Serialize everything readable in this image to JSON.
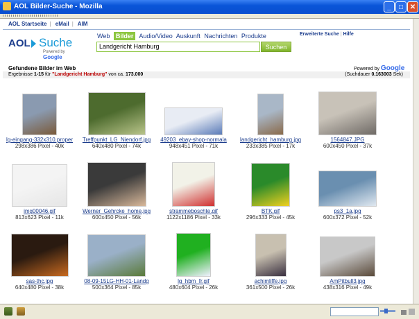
{
  "window": {
    "title": "AOL Bilder-Suche - Mozilla"
  },
  "topnav": [
    "AOL Startseite",
    "eMail",
    "AIM"
  ],
  "logo": {
    "brand": "AOL",
    "product": "Suche",
    "powered": "Powered by",
    "google": "Google"
  },
  "tabs": [
    "Web",
    "Bilder",
    "Audio/Video",
    "Auskunft",
    "Nachrichten",
    "Produkte"
  ],
  "active_tab": "Bilder",
  "search": {
    "value": "Landgericht Hamburg",
    "button": "Suchen"
  },
  "sidelinks": [
    "Erweiterte Suche",
    "Hilfe"
  ],
  "heading": "Gefundene Bilder im Web",
  "powered_right": {
    "text": "Powered by",
    "google": "Google"
  },
  "results": {
    "prefix": "Ergebnisse",
    "range": "1-15",
    "for": "für",
    "query": "\"Landgericht Hamburg\"",
    "of": "von ca.",
    "total": "173.000",
    "duration_label": "(Suchdauer",
    "duration": "0.163003",
    "duration_unit": "Sek)"
  },
  "images": [
    {
      "file": "lg-eingang-332x310.proper",
      "meta": "298x386 Pixel - 40k",
      "tw": 50,
      "th": 60,
      "colors": [
        "#8a9ab0",
        "#7a5a3a"
      ]
    },
    {
      "file": "Treffpunkt_LG_Niendorf.jpg",
      "meta": "640x480 Pixel - 74k",
      "tw": 83,
      "th": 62,
      "colors": [
        "#4d6b2e",
        "#b9c48a"
      ]
    },
    {
      "file": "49203_ebay-shop-normala",
      "meta": "948x451 Pixel - 71k",
      "tw": 84,
      "th": 40,
      "colors": [
        "#e8ecf4",
        "#5a7bb8"
      ]
    },
    {
      "file": "landgericht_hamburg.jpg",
      "meta": "233x385 Pixel - 17k",
      "tw": 38,
      "th": 60,
      "colors": [
        "#a9b7c7",
        "#8a6a4a"
      ]
    },
    {
      "file": "1564847.JPG",
      "meta": "600x450 Pixel - 37k",
      "tw": 84,
      "th": 63,
      "colors": [
        "#c8c2b8",
        "#6f6a66"
      ]
    },
    {
      "file": "img00046.gif",
      "meta": "813x623 Pixel - 11k",
      "tw": 80,
      "th": 61,
      "colors": [
        "#f4f4f4",
        "#e6e6e6"
      ]
    },
    {
      "file": "Werner_Gehrcke_home.jpg",
      "meta": "600x450 Pixel - 56k",
      "tw": 85,
      "th": 64,
      "colors": [
        "#3a3a3a",
        "#d8b89a"
      ]
    },
    {
      "file": "strammeboschte.gif",
      "meta": "1122x1186 Pixel - 33k",
      "tw": 62,
      "th": 64,
      "colors": [
        "#f2f2e8",
        "#d03030"
      ]
    },
    {
      "file": "BTK.gif",
      "meta": "296x333 Pixel - 45k",
      "tw": 56,
      "th": 63,
      "colors": [
        "#2a8a2a",
        "#f0d020"
      ]
    },
    {
      "file": "ps3_1a.jpg",
      "meta": "600x372 Pixel - 52k",
      "tw": 84,
      "th": 52,
      "colors": [
        "#6a8fb0",
        "#e0e8f0"
      ]
    },
    {
      "file": "sas-thc.jpg",
      "meta": "640x480 Pixel - 38k",
      "tw": 83,
      "th": 62,
      "colors": [
        "#2a1a10",
        "#c86a20"
      ]
    },
    {
      "file": "08-09-15LG-HH-01-Landg",
      "meta": "500x364 Pixel - 85k",
      "tw": 84,
      "th": 61,
      "colors": [
        "#9ab0c8",
        "#5a7a3a"
      ]
    },
    {
      "file": "lg_hbm_fr.gif",
      "meta": "480x604 Pixel - 26k",
      "tw": 50,
      "th": 63,
      "colors": [
        "#20b020",
        "#f0f0ff"
      ]
    },
    {
      "file": "achimliffe.jpg",
      "meta": "361x500 Pixel - 26k",
      "tw": 45,
      "th": 62,
      "colors": [
        "#c8c0b0",
        "#3a3040"
      ]
    },
    {
      "file": "AmPitbull3.jpg",
      "meta": "438x316 Pixel - 49k",
      "tw": 80,
      "th": 58,
      "colors": [
        "#c8c8c8",
        "#5a4a3a"
      ]
    }
  ]
}
